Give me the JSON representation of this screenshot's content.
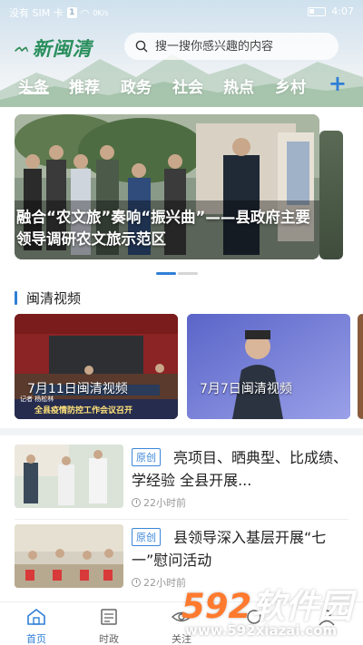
{
  "status_bar": {
    "carrier": "没有 SIM 卡",
    "sim_badge": "1",
    "net": "0K/s",
    "time": "4:07"
  },
  "header": {
    "logo_text": "新闽清",
    "search": {
      "placeholder": "搜一搜你感兴趣的内容"
    },
    "tabs": [
      "头条",
      "推荐",
      "政务",
      "社会",
      "热点",
      "乡村"
    ],
    "active_tab": "头条",
    "add_icon": "plus-icon"
  },
  "banner": {
    "caption": "融合“农文旅”奏响“振兴曲”——县政府主要领导调研农文旅示范区",
    "slide_index": 1,
    "slide_count": 2
  },
  "video_section": {
    "title": "闽清视频",
    "videos": [
      {
        "label": "7月11日闽清视频",
        "overlay": "全县疫情防控工作会议召开",
        "reporter": "记者 杨松林"
      },
      {
        "label": "7月7日闽清视频"
      }
    ]
  },
  "news": [
    {
      "badge": "原创",
      "title": "亮项目、晒典型、比成绩、学经验 全县开展...",
      "time": "22小时前"
    },
    {
      "badge": "原创",
      "title": "县领导深入基层开展“七一”慰问活动",
      "time": "22小时前"
    }
  ],
  "bottom_nav": [
    {
      "label": "首页",
      "icon": "home-icon"
    },
    {
      "label": "时政",
      "icon": "newspaper-icon"
    },
    {
      "label": "关注",
      "icon": "eye-icon"
    },
    {
      "label": "",
      "icon": "service-icon"
    },
    {
      "label": "",
      "icon": "user-icon"
    }
  ],
  "watermark": {
    "brand_num": "592",
    "brand_text": "软件园",
    "url": "www.592xiazai.com"
  },
  "colors": {
    "accent": "#2f7fd6",
    "logo_green": "#2a8f5d",
    "watermark_orange": "#ff7a2e"
  }
}
